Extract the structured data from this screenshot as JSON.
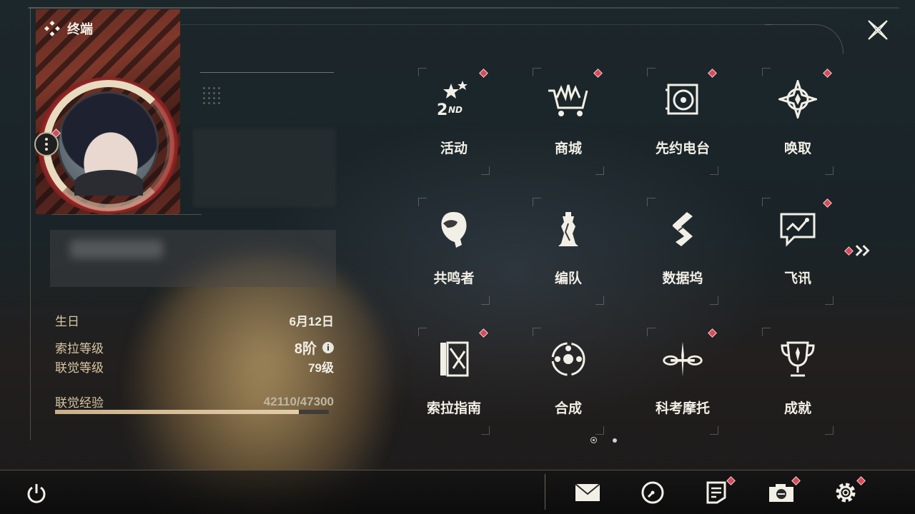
{
  "header": {
    "title": "终端"
  },
  "profile": {
    "rows": [
      {
        "label": "生日",
        "value": "6月12日"
      },
      {
        "label": "索拉等级",
        "value": "8阶"
      },
      {
        "label": "联觉等级",
        "value": "79级"
      },
      {
        "label": "联觉经验",
        "value": "42110/47300"
      }
    ],
    "exp_current": 42110,
    "exp_max": 47300
  },
  "menu": {
    "items": [
      {
        "label": "活动",
        "icon": "event-2nd-icon",
        "badge": true
      },
      {
        "label": "商城",
        "icon": "shop-cart-icon",
        "badge": true
      },
      {
        "label": "先约电台",
        "icon": "radio-icon",
        "badge": true
      },
      {
        "label": "唤取",
        "icon": "convene-compass-icon",
        "badge": true
      },
      {
        "label": "共鸣者",
        "icon": "resonator-head-icon",
        "badge": false
      },
      {
        "label": "编队",
        "icon": "team-chess-icon",
        "badge": false
      },
      {
        "label": "数据坞",
        "icon": "data-bank-icon",
        "badge": false
      },
      {
        "label": "飞讯",
        "icon": "message-chat-icon",
        "badge": true
      },
      {
        "label": "索拉指南",
        "icon": "guidebook-icon",
        "badge": true
      },
      {
        "label": "合成",
        "icon": "synthesis-icon",
        "badge": false
      },
      {
        "label": "科考摩托",
        "icon": "motorcycle-icon",
        "badge": true
      },
      {
        "label": "成就",
        "icon": "trophy-icon",
        "badge": false
      }
    ],
    "pages": 2,
    "current_page": 1
  },
  "bottom_bar": {
    "buttons": [
      {
        "icon": "mail-icon",
        "badge": false
      },
      {
        "icon": "clock-icon",
        "badge": false
      },
      {
        "icon": "notice-icon",
        "badge": true
      },
      {
        "icon": "camera-icon",
        "badge": true
      },
      {
        "icon": "settings-gear-icon",
        "badge": true
      }
    ]
  },
  "colors": {
    "badge": "#d84a57",
    "accent_gold": "#d9c7a2",
    "text": "#f2efe6"
  }
}
